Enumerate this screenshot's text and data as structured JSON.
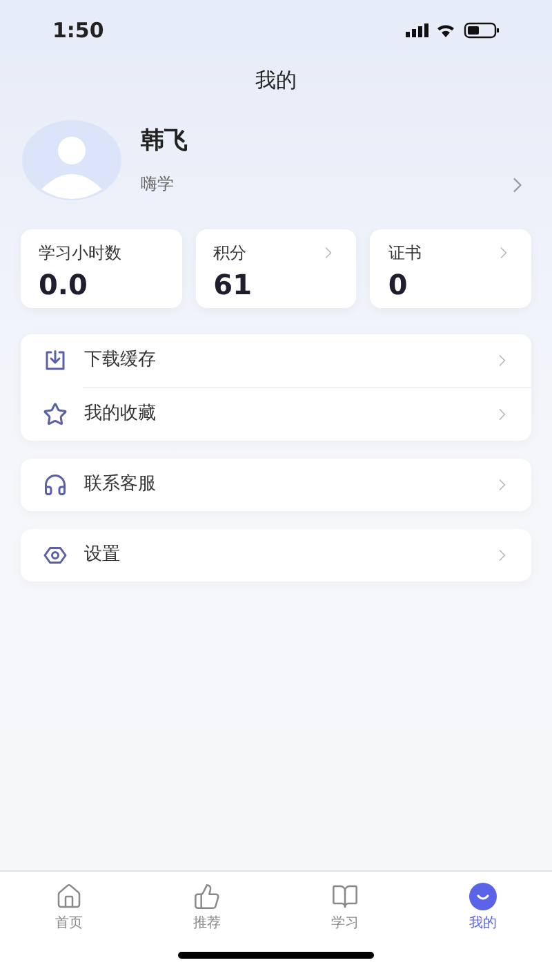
{
  "status_bar": {
    "time": "1:50"
  },
  "header": {
    "title": "我的"
  },
  "profile": {
    "name": "韩飞",
    "subtitle": "嗨学"
  },
  "stats": [
    {
      "label": "学习小时数",
      "value": "0.0",
      "has_arrow": false
    },
    {
      "label": "积分",
      "value": "61",
      "has_arrow": true
    },
    {
      "label": "证书",
      "value": "0",
      "has_arrow": true
    }
  ],
  "menu_groups": [
    {
      "items": [
        {
          "kind": "download",
          "label": "下载缓存"
        },
        {
          "kind": "star",
          "label": "我的收藏"
        }
      ]
    },
    {
      "items": [
        {
          "kind": "headset",
          "label": "联系客服"
        }
      ]
    },
    {
      "items": [
        {
          "kind": "settings",
          "label": "设置"
        }
      ]
    }
  ],
  "tab_bar": [
    {
      "kind": "home",
      "label": "首页",
      "selected": false
    },
    {
      "kind": "thumb",
      "label": "推荐",
      "selected": false
    },
    {
      "kind": "book",
      "label": "学习",
      "selected": false
    },
    {
      "kind": "me",
      "label": "我的",
      "selected": true
    }
  ]
}
